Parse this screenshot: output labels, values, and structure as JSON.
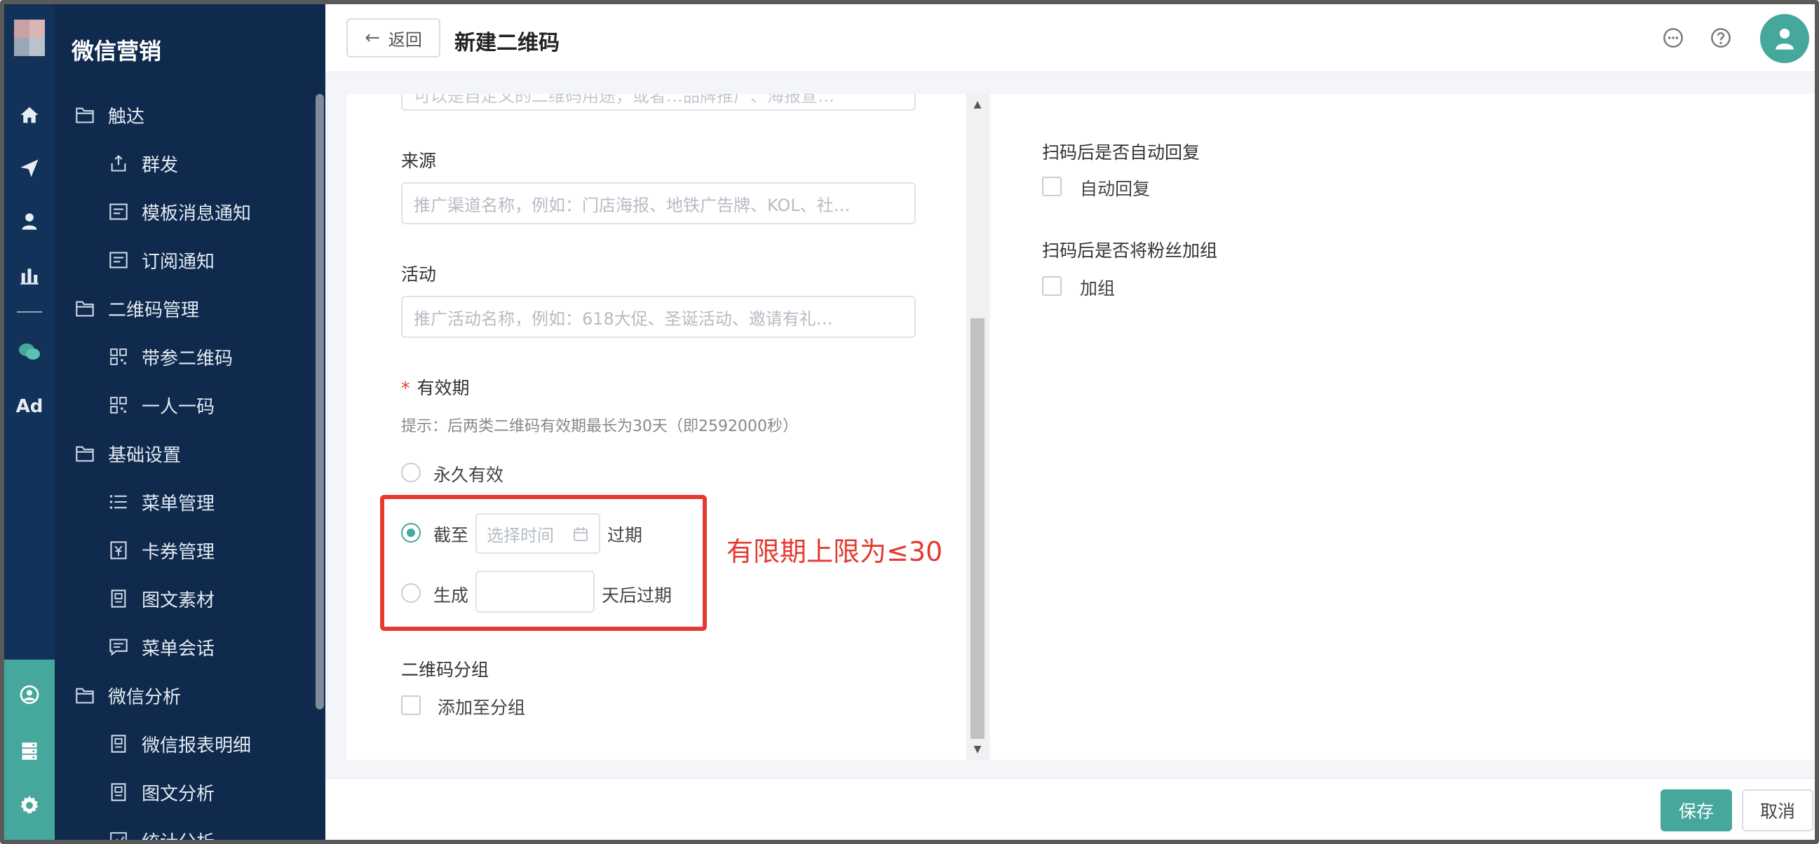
{
  "colors": {
    "accent": "#46a89c",
    "sidebar_bg": "#0f2a4d",
    "rail_bg": "#12325a",
    "annotation_red": "#e53a2f"
  },
  "rail": {
    "icons": [
      "home-icon",
      "send-icon",
      "user-icon",
      "bar-chart-icon",
      "wechat-icon"
    ],
    "ad_label": "Ad",
    "bottom_icons": [
      "community-icon",
      "server-icon",
      "gear-icon"
    ]
  },
  "sidebar": {
    "title": "微信营销",
    "items": [
      {
        "label": "触达",
        "type": "group",
        "icon": "folder-icon"
      },
      {
        "label": "群发",
        "type": "child",
        "icon": "broadcast-icon"
      },
      {
        "label": "模板消息通知",
        "type": "child",
        "icon": "template-icon"
      },
      {
        "label": "订阅通知",
        "type": "child",
        "icon": "template-icon"
      },
      {
        "label": "二维码管理",
        "type": "group",
        "icon": "folder-icon"
      },
      {
        "label": "带参二维码",
        "type": "child",
        "icon": "qrcode-icon"
      },
      {
        "label": "一人一码",
        "type": "child",
        "icon": "qrcode-icon"
      },
      {
        "label": "基础设置",
        "type": "group",
        "icon": "folder-icon"
      },
      {
        "label": "菜单管理",
        "type": "child",
        "icon": "list-icon"
      },
      {
        "label": "卡券管理",
        "type": "child",
        "icon": "coupon-icon"
      },
      {
        "label": "图文素材",
        "type": "child",
        "icon": "document-icon"
      },
      {
        "label": "菜单会话",
        "type": "child",
        "icon": "chat-icon"
      },
      {
        "label": "微信分析",
        "type": "group",
        "icon": "folder-icon"
      },
      {
        "label": "微信报表明细",
        "type": "child",
        "icon": "document-icon"
      },
      {
        "label": "图文分析",
        "type": "child",
        "icon": "document-icon"
      },
      {
        "label": "统计分析",
        "type": "child",
        "icon": "chart-icon"
      }
    ]
  },
  "header": {
    "back_label": "返回",
    "title": "新建二维码",
    "icons": [
      "chat-bubble-icon",
      "help-icon",
      "avatar-user-icon"
    ]
  },
  "form": {
    "truncated_placeholder": "可以是自定义的二维码用途，或者…品牌推广、海报宣…",
    "source_label": "来源",
    "source_placeholder": "推广渠道名称，例如：门店海报、地铁广告牌、KOL、社…",
    "activity_label": "活动",
    "activity_placeholder": "推广活动名称，例如：618大促、圣诞活动、邀请有礼…",
    "validity_required_mark": "*",
    "validity_label": "有效期",
    "validity_hint": "提示：后两类二维码有效期最长为30天（即2592000秒）",
    "option_permanent": "永久有效",
    "option_until": "截至",
    "date_placeholder": "选择时间",
    "until_suffix": "过期",
    "option_generate": "生成",
    "days_suffix": "天后过期",
    "group_label": "二维码分组",
    "add_to_group": "添加至分组",
    "selected_option": "截至"
  },
  "annotation": {
    "text": "有限期上限为≤30"
  },
  "right": {
    "auto_reply_question": "扫码后是否自动回复",
    "auto_reply_option": "自动回复",
    "add_group_question": "扫码后是否将粉丝加组",
    "add_group_option": "加组"
  },
  "footer": {
    "save_label": "保存",
    "cancel_label": "取消"
  }
}
